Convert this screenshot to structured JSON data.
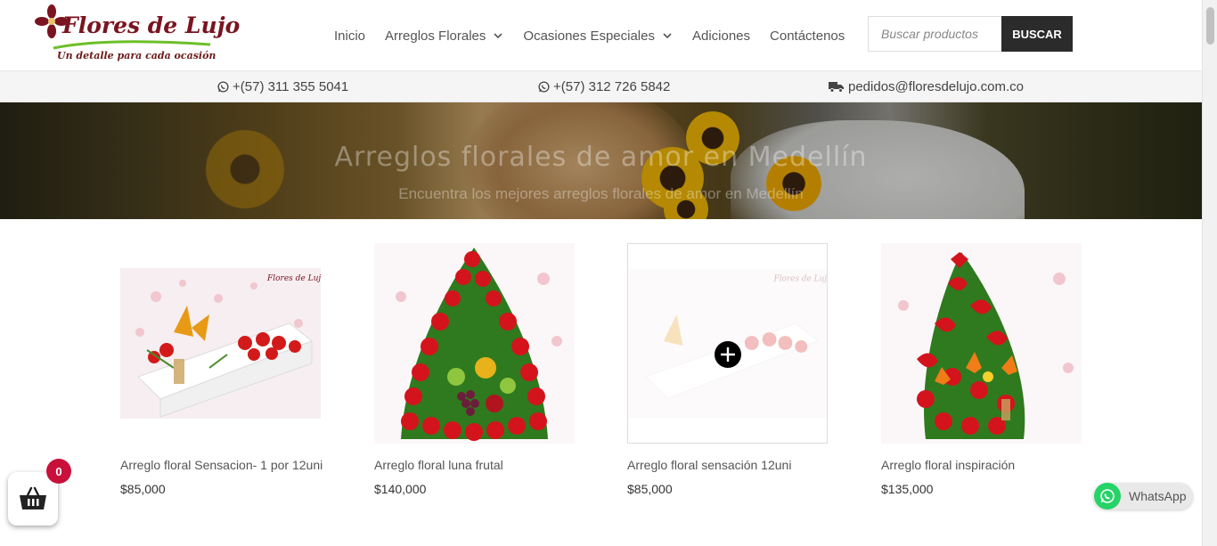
{
  "brand": {
    "name": "Flores de Lujo",
    "tagline": "Un detalle para cada ocasión"
  },
  "nav": {
    "items": [
      {
        "label": "Inicio",
        "has_dropdown": false
      },
      {
        "label": "Arreglos Florales",
        "has_dropdown": true
      },
      {
        "label": "Ocasiones Especiales",
        "has_dropdown": true
      },
      {
        "label": "Adiciones",
        "has_dropdown": false
      },
      {
        "label": "Contáctenos",
        "has_dropdown": false
      }
    ]
  },
  "search": {
    "placeholder": "Buscar productos",
    "button_label": "BUSCAR"
  },
  "contact": {
    "phone1": "+(57) 311 355 5041",
    "phone2": "+(57) 312 726 5842",
    "email": "pedidos@floresdelujo.com.co",
    "phone_icon": "whatsapp-icon",
    "email_icon": "truck-icon"
  },
  "hero": {
    "title": "Arreglos florales de amor en Medellín",
    "subtitle": "Encuentra los mejores arreglos florales de amor en Medellín"
  },
  "products": [
    {
      "name": "Arreglo floral Sensacion- 1 por 12uni",
      "price": "$85,000"
    },
    {
      "name": "Arreglo floral luna frutal",
      "price": "$140,000"
    },
    {
      "name": "Arreglo floral sensación 12uni",
      "price": "$85,000"
    },
    {
      "name": "Arreglo floral inspiración",
      "price": "$135,000"
    }
  ],
  "cart": {
    "count": "0",
    "icon": "basket-icon"
  },
  "whatsapp": {
    "label": "WhatsApp"
  },
  "colors": {
    "brand": "#7a1420",
    "button_dark": "#2b2b2b",
    "cart_badge": "#c8103a",
    "whatsapp": "#25d366"
  }
}
